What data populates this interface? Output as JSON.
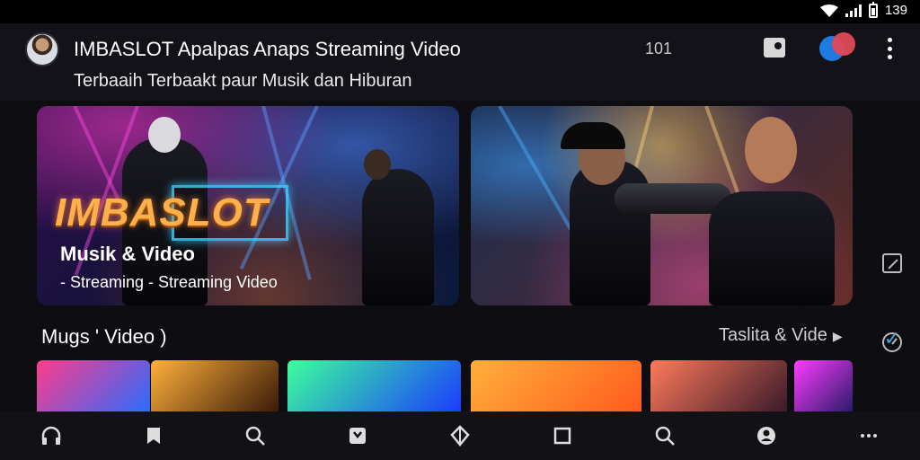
{
  "status_bar": {
    "time": "139",
    "icons": [
      "wifi-icon",
      "signal-icon",
      "battery-icon"
    ]
  },
  "header": {
    "title": "IMBASLOT Apalpas Anaps Streaming Video",
    "subtitle": "Terbaaih Terbaakt paur Musik dan Hiburan",
    "count": "101",
    "icons": [
      "avatar",
      "cast-icon",
      "profile-icon",
      "more-vert-icon"
    ]
  },
  "banners": [
    {
      "brand": "IMBASLOT",
      "line1": "Musik & Video",
      "line2": "- Streaming - Streaming Video"
    },
    {
      "brand": "",
      "line1": "",
      "line2": ""
    }
  ],
  "section": {
    "title": "Mugs ' Video )",
    "link": "Taslita & Vide"
  },
  "thumbnails": [
    {
      "caption": "",
      "colors": [
        "#ff3c8a",
        "#2a6cff"
      ]
    },
    {
      "caption": "",
      "colors": [
        "#ffb03a",
        "#3a1a08"
      ]
    },
    {
      "caption": "",
      "colors": [
        "#3cff9a",
        "#1a3cff"
      ]
    },
    {
      "caption": "",
      "colors": [
        "#ffb03a",
        "#ff5a1e"
      ]
    },
    {
      "caption": "",
      "colors": [
        "#ff7a5a",
        "#3a1a2a"
      ]
    },
    {
      "caption": "",
      "colors": [
        "#ff3cff",
        "#2a1a6a"
      ]
    }
  ],
  "side_icons": [
    "edit-icon",
    "clock-icon",
    "check-icon"
  ],
  "bottom_nav": [
    "headphones-icon",
    "bookmark-icon",
    "search-icon",
    "playlist-icon",
    "diamond-icon",
    "square-icon",
    "search-icon",
    "account-icon",
    "more-horiz-icon"
  ],
  "colors": {
    "brand": "#ffb04a",
    "accent_blue": "#1f7be0",
    "accent_red": "#e04a56",
    "check": "#3ea8d8"
  }
}
